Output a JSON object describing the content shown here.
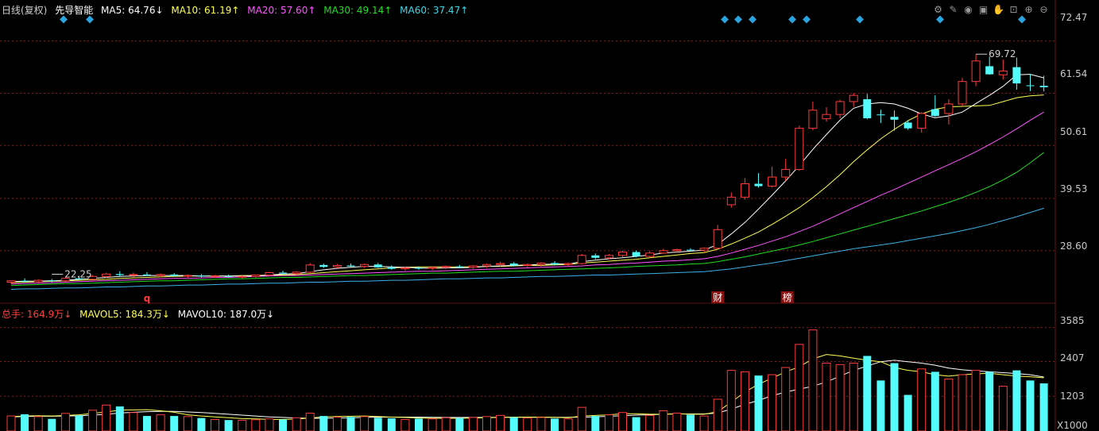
{
  "header": {
    "period": "日线(复权)",
    "stock": "先导智能",
    "ma5": "MA5: 64.76↓",
    "ma10": "MA10: 61.19↑",
    "ma20": "MA20: 57.60↑",
    "ma30": "MA30: 49.14↑",
    "ma60": "MA60: 37.47↑"
  },
  "volume_header": {
    "total": "总手: 164.9万↓",
    "mavol5": "MAVOL5: 184.3万↓",
    "mavol10": "MAVOL10: 187.0万↓"
  },
  "toolbar": [
    "settings-icon",
    "pen-icon",
    "eye-icon",
    "briefcase-icon",
    "hand-icon",
    "lock-icon",
    "zoom-in-icon",
    "zoom-out-icon"
  ],
  "markers": {
    "q": "q",
    "cai": "财",
    "bang": "榜",
    "high_label": "69.72",
    "low_label": "22.25"
  },
  "colors": {
    "up": "#ff3c3c",
    "down": "#54fcfc",
    "ma5": "#ffffff",
    "ma10": "#ffff55",
    "ma20": "#ff55ff",
    "ma30": "#22dd22",
    "ma60": "#3fb0e8",
    "grid": "#8b1a1a",
    "header_ma5": "#ffffff",
    "header_ma10": "#ffff55",
    "header_ma20": "#ff55ff",
    "header_ma30": "#22dd22",
    "header_ma60": "#3fd6e8"
  },
  "chart_data": [
    {
      "type": "candlestick",
      "title": "先导智能",
      "y_ticks": [
        "72.47",
        "61.54",
        "50.61",
        "39.53",
        "28.60"
      ],
      "y_tick_values": [
        72.47,
        61.54,
        50.61,
        39.53,
        28.6
      ],
      "ylim": [
        17.6,
        77.4
      ],
      "grid": true,
      "candles": [
        [
          22.0,
          22.4,
          21.6,
          22.3
        ],
        [
          22.3,
          22.8,
          21.9,
          22.1
        ],
        [
          22.1,
          22.6,
          21.8,
          22.4
        ],
        [
          22.4,
          22.7,
          22.0,
          22.25
        ],
        [
          22.3,
          23.0,
          22.0,
          22.8
        ],
        [
          22.8,
          23.3,
          22.5,
          22.6
        ],
        [
          22.6,
          23.5,
          22.3,
          23.2
        ],
        [
          23.2,
          24.0,
          22.9,
          23.7
        ],
        [
          23.7,
          24.3,
          23.2,
          23.5
        ],
        [
          23.5,
          24.0,
          23.0,
          23.6
        ],
        [
          23.6,
          24.1,
          23.3,
          23.4
        ],
        [
          23.4,
          23.8,
          23.0,
          23.6
        ],
        [
          23.6,
          23.9,
          23.2,
          23.3
        ],
        [
          23.3,
          23.6,
          22.9,
          23.4
        ],
        [
          23.4,
          23.7,
          23.0,
          23.2
        ],
        [
          23.2,
          23.5,
          22.9,
          23.3
        ],
        [
          23.3,
          23.6,
          23.0,
          23.1
        ],
        [
          23.1,
          23.4,
          22.8,
          23.2
        ],
        [
          23.2,
          23.6,
          22.9,
          23.5
        ],
        [
          23.5,
          24.2,
          23.2,
          24.0
        ],
        [
          24.0,
          24.4,
          23.6,
          23.8
        ],
        [
          23.8,
          24.3,
          23.5,
          24.1
        ],
        [
          24.1,
          26.0,
          23.9,
          25.6
        ],
        [
          25.6,
          25.9,
          25.0,
          25.2
        ],
        [
          25.2,
          25.8,
          24.9,
          25.5
        ],
        [
          25.5,
          25.9,
          25.0,
          25.3
        ],
        [
          25.3,
          25.9,
          25.0,
          25.7
        ],
        [
          25.7,
          26.0,
          25.0,
          25.1
        ],
        [
          25.1,
          25.5,
          24.6,
          24.8
        ],
        [
          24.8,
          25.2,
          24.4,
          25.0
        ],
        [
          25.0,
          25.3,
          24.6,
          24.9
        ],
        [
          24.9,
          25.3,
          24.5,
          25.1
        ],
        [
          25.1,
          25.5,
          24.7,
          25.3
        ],
        [
          25.3,
          25.6,
          24.9,
          25.1
        ],
        [
          25.1,
          25.6,
          24.8,
          25.4
        ],
        [
          25.4,
          25.9,
          25.0,
          25.7
        ],
        [
          25.7,
          26.3,
          25.3,
          25.9
        ],
        [
          25.9,
          26.2,
          25.3,
          25.5
        ],
        [
          25.5,
          25.9,
          25.1,
          25.7
        ],
        [
          25.7,
          26.2,
          25.3,
          26.0
        ],
        [
          26.0,
          26.4,
          25.5,
          25.7
        ],
        [
          25.7,
          26.1,
          25.3,
          25.9
        ],
        [
          25.9,
          27.9,
          25.7,
          27.6
        ],
        [
          27.6,
          28.0,
          26.8,
          27.1
        ],
        [
          27.1,
          27.9,
          26.8,
          27.6
        ],
        [
          27.6,
          28.6,
          27.2,
          28.3
        ],
        [
          28.3,
          28.6,
          27.2,
          27.4
        ],
        [
          27.4,
          28.5,
          27.1,
          28.1
        ],
        [
          28.1,
          29.0,
          28.0,
          28.6
        ],
        [
          28.6,
          29.0,
          28.2,
          28.8
        ],
        [
          28.8,
          29.1,
          28.4,
          28.7
        ],
        [
          28.7,
          29.3,
          28.2,
          29.1
        ],
        [
          29.1,
          34.0,
          28.9,
          33.0
        ],
        [
          38.2,
          40.8,
          37.6,
          39.8
        ],
        [
          39.8,
          43.8,
          39.3,
          42.6
        ],
        [
          42.6,
          44.8,
          41.8,
          42.1
        ],
        [
          42.1,
          46.2,
          41.8,
          44.0
        ],
        [
          44.0,
          47.8,
          43.2,
          45.6
        ],
        [
          45.6,
          54.8,
          45.3,
          54.2
        ],
        [
          54.2,
          59.8,
          53.8,
          58.0
        ],
        [
          56.2,
          58.6,
          55.6,
          57.1
        ],
        [
          57.1,
          60.2,
          56.3,
          59.8
        ],
        [
          59.8,
          61.6,
          58.7,
          61.1
        ],
        [
          60.3,
          61.4,
          56.1,
          56.3
        ],
        [
          57.1,
          58.1,
          55.3,
          57.0
        ],
        [
          56.6,
          57.9,
          53.7,
          56.0
        ],
        [
          55.4,
          55.8,
          53.9,
          54.2
        ],
        [
          54.2,
          57.6,
          53.3,
          57.3
        ],
        [
          58.2,
          61.1,
          56.6,
          56.8
        ],
        [
          57.3,
          60.3,
          55.0,
          59.3
        ],
        [
          59.3,
          64.8,
          58.8,
          64.0
        ],
        [
          64.0,
          69.72,
          63.0,
          68.3
        ],
        [
          67.2,
          69.2,
          65.4,
          65.5
        ],
        [
          65.4,
          68.6,
          64.4,
          66.2
        ],
        [
          67.0,
          69.0,
          62.3,
          63.6
        ],
        [
          63.2,
          65.6,
          62.0,
          63.1
        ],
        [
          63.1,
          65.2,
          61.9,
          62.8
        ]
      ],
      "ma5": [
        22.1,
        22.2,
        22.2,
        22.3,
        22.4,
        22.6,
        22.8,
        23.0,
        23.2,
        23.3,
        23.4,
        23.4,
        23.4,
        23.4,
        23.3,
        23.3,
        23.3,
        23.3,
        23.3,
        23.5,
        23.7,
        23.8,
        24.2,
        24.6,
        24.9,
        25.1,
        25.3,
        25.3,
        25.2,
        25.1,
        25.0,
        24.9,
        25.0,
        25.0,
        25.1,
        25.3,
        25.4,
        25.5,
        25.6,
        25.7,
        25.8,
        25.8,
        26.3,
        26.6,
        26.9,
        27.1,
        27.4,
        27.7,
        28.1,
        28.3,
        28.5,
        28.7,
        29.9,
        32.1,
        34.5,
        37.3,
        40.2,
        43.2,
        46.4,
        49.8,
        52.9,
        55.9,
        58.4,
        59.3,
        59.6,
        59.3,
        58.4,
        57.2,
        56.4,
        56.8,
        57.6,
        59.4,
        61.1,
        63.0,
        65.4,
        65.5,
        64.76
      ],
      "ma10": [
        21.9,
        22.0,
        22.1,
        22.2,
        22.3,
        22.4,
        22.5,
        22.6,
        22.8,
        22.9,
        23.0,
        23.1,
        23.2,
        23.3,
        23.3,
        23.3,
        23.3,
        23.4,
        23.4,
        23.5,
        23.5,
        23.6,
        23.8,
        24.0,
        24.2,
        24.4,
        24.6,
        24.8,
        25.0,
        25.1,
        25.2,
        25.2,
        25.2,
        25.2,
        25.2,
        25.3,
        25.3,
        25.4,
        25.5,
        25.5,
        25.6,
        25.7,
        26.0,
        26.2,
        26.4,
        26.6,
        26.8,
        27.1,
        27.4,
        27.7,
        28.0,
        28.2,
        28.9,
        30.0,
        31.2,
        32.5,
        34.1,
        35.8,
        37.6,
        39.7,
        42.0,
        44.5,
        47.2,
        49.7,
        52.0,
        54.0,
        55.8,
        57.2,
        58.2,
        58.7,
        58.8,
        58.9,
        59.0,
        59.8,
        60.6,
        61.0,
        61.19
      ],
      "ma20": [
        21.6,
        21.7,
        21.8,
        21.9,
        22.0,
        22.1,
        22.2,
        22.3,
        22.4,
        22.5,
        22.6,
        22.7,
        22.8,
        22.8,
        22.9,
        23.0,
        23.0,
        23.1,
        23.2,
        23.3,
        23.4,
        23.4,
        23.5,
        23.6,
        23.7,
        23.8,
        23.9,
        24.0,
        24.1,
        24.2,
        24.3,
        24.3,
        24.4,
        24.5,
        24.6,
        24.7,
        24.8,
        24.9,
        25.0,
        25.1,
        25.2,
        25.3,
        25.4,
        25.6,
        25.7,
        25.9,
        26.0,
        26.2,
        26.4,
        26.5,
        26.7,
        26.9,
        27.4,
        28.1,
        28.9,
        29.7,
        30.6,
        31.5,
        32.6,
        33.7,
        35.0,
        36.3,
        37.6,
        38.9,
        40.2,
        41.4,
        42.7,
        44.0,
        45.3,
        46.6,
        47.9,
        49.3,
        50.8,
        52.4,
        54.1,
        55.9,
        57.6
      ],
      "ma30": [
        21.3,
        21.4,
        21.5,
        21.6,
        21.7,
        21.7,
        21.8,
        21.9,
        22.0,
        22.1,
        22.2,
        22.3,
        22.3,
        22.4,
        22.5,
        22.6,
        22.7,
        22.7,
        22.8,
        22.9,
        23.0,
        23.0,
        23.1,
        23.2,
        23.3,
        23.4,
        23.4,
        23.5,
        23.6,
        23.7,
        23.8,
        23.9,
        23.9,
        24.0,
        24.1,
        24.2,
        24.3,
        24.3,
        24.4,
        24.5,
        24.6,
        24.7,
        24.8,
        24.9,
        25.0,
        25.1,
        25.3,
        25.4,
        25.5,
        25.6,
        25.8,
        25.9,
        26.3,
        26.8,
        27.3,
        27.9,
        28.5,
        29.1,
        29.8,
        30.5,
        31.3,
        32.1,
        32.9,
        33.7,
        34.5,
        35.3,
        36.1,
        36.9,
        37.8,
        38.7,
        39.7,
        40.8,
        42.0,
        43.4,
        45.0,
        47.0,
        49.14
      ],
      "ma60": [
        20.5,
        20.6,
        20.6,
        20.7,
        20.8,
        20.8,
        20.9,
        21.0,
        21.0,
        21.1,
        21.2,
        21.2,
        21.3,
        21.4,
        21.4,
        21.5,
        21.6,
        21.6,
        21.7,
        21.8,
        21.8,
        21.9,
        22.0,
        22.0,
        22.1,
        22.2,
        22.2,
        22.3,
        22.4,
        22.4,
        22.5,
        22.6,
        22.7,
        22.7,
        22.8,
        22.9,
        22.9,
        23.0,
        23.1,
        23.2,
        23.2,
        23.3,
        23.4,
        23.5,
        23.5,
        23.6,
        23.7,
        23.8,
        23.9,
        24.0,
        24.1,
        24.2,
        24.5,
        24.8,
        25.2,
        25.6,
        26.0,
        26.5,
        27.0,
        27.5,
        28.0,
        28.5,
        29.0,
        29.4,
        29.8,
        30.2,
        30.7,
        31.2,
        31.7,
        32.2,
        32.8,
        33.4,
        34.1,
        34.9,
        35.7,
        36.6,
        37.47
      ]
    },
    {
      "type": "bar",
      "title": "总手",
      "y_ticks": [
        "3585",
        "2407",
        "1203"
      ],
      "y_tick_values": [
        3585,
        2407,
        1203
      ],
      "unit_label": "X1000",
      "ylim": [
        0,
        3931
      ],
      "volumes": [
        520,
        580,
        500,
        420,
        610,
        540,
        720,
        900,
        850,
        640,
        520,
        560,
        520,
        500,
        450,
        400,
        380,
        370,
        390,
        420,
        400,
        460,
        620,
        520,
        480,
        490,
        500,
        460,
        440,
        400,
        430,
        420,
        460,
        450,
        470,
        500,
        540,
        480,
        450,
        470,
        430,
        420,
        820,
        520,
        560,
        640,
        480,
        540,
        700,
        620,
        560,
        520,
        1100,
        2100,
        2050,
        1920,
        1950,
        2200,
        3000,
        3500,
        2350,
        2300,
        2350,
        2600,
        1750,
        2350,
        1250,
        2150,
        2050,
        1800,
        1950,
        2100,
        2050,
        1550,
        2100,
        1750,
        1649
      ],
      "mavol5": [
        500,
        520,
        530,
        520,
        540,
        560,
        610,
        660,
        720,
        730,
        740,
        700,
        650,
        560,
        520,
        490,
        460,
        430,
        420,
        400,
        400,
        410,
        450,
        490,
        500,
        510,
        520,
        500,
        480,
        470,
        450,
        440,
        440,
        440,
        450,
        460,
        470,
        480,
        480,
        480,
        470,
        460,
        520,
        540,
        560,
        600,
        600,
        580,
        580,
        600,
        580,
        580,
        670,
        1000,
        1350,
        1620,
        1830,
        2050,
        2220,
        2500,
        2650,
        2600,
        2520,
        2450,
        2400,
        2200,
        2100,
        2050,
        1950,
        1900,
        1950,
        1980,
        2000,
        1950,
        1900,
        1880,
        1843
      ],
      "mavol10": [
        490,
        500,
        510,
        510,
        520,
        530,
        550,
        580,
        620,
        650,
        670,
        680,
        680,
        660,
        640,
        610,
        580,
        550,
        520,
        490,
        470,
        450,
        440,
        440,
        450,
        460,
        470,
        480,
        480,
        480,
        480,
        475,
        470,
        470,
        470,
        470,
        475,
        475,
        475,
        475,
        475,
        475,
        480,
        490,
        510,
        530,
        550,
        560,
        580,
        590,
        590,
        590,
        620,
        760,
        920,
        1060,
        1220,
        1350,
        1450,
        1550,
        1700,
        1900,
        2100,
        2250,
        2400,
        2450,
        2400,
        2350,
        2280,
        2180,
        2120,
        2080,
        2050,
        2020,
        1990,
        1950,
        1870
      ]
    }
  ]
}
